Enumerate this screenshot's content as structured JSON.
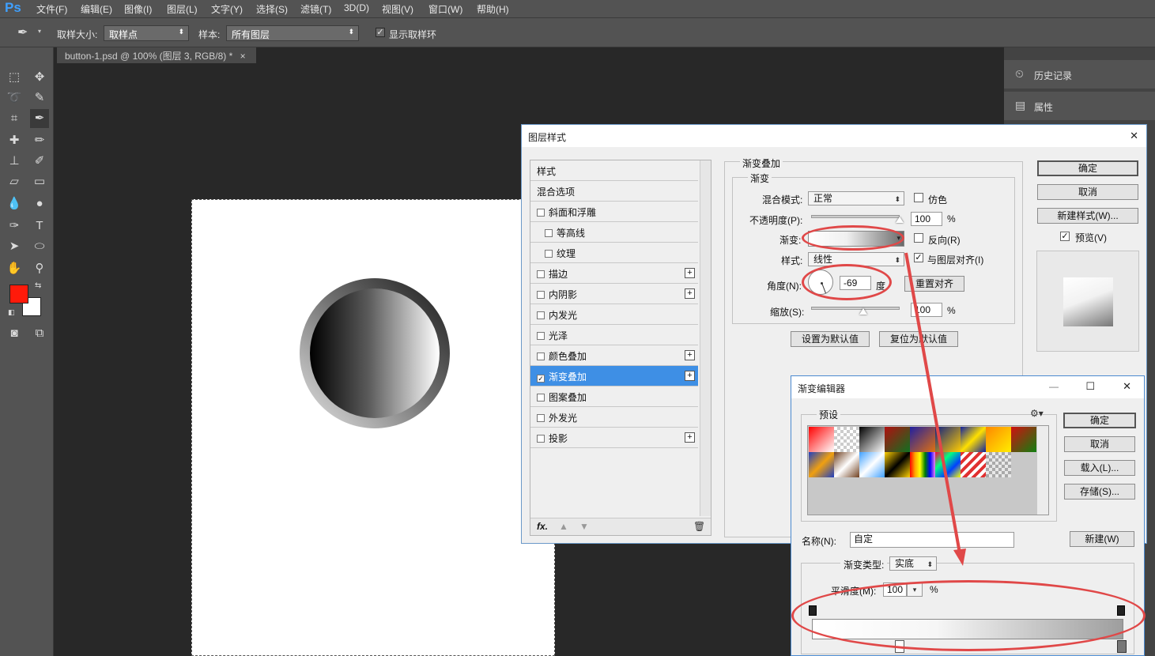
{
  "app": {
    "logo": "Ps"
  },
  "menu": [
    "文件(F)",
    "编辑(E)",
    "图像(I)",
    "图层(L)",
    "文字(Y)",
    "选择(S)",
    "滤镜(T)",
    "3D(D)",
    "视图(V)",
    "窗口(W)",
    "帮助(H)"
  ],
  "options": {
    "sample_size_label": "取样大小:",
    "sample_size_value": "取样点",
    "sample_label": "样本:",
    "sample_value": "所有图层",
    "show_ring_label": "显示取样环"
  },
  "doc_tab": {
    "title": "button-1.psd @ 100% (图层 3, RGB/8) *",
    "close": "×"
  },
  "right_panel": {
    "history": "历史记录",
    "properties": "属性"
  },
  "colors": {
    "foreground": "#ff1a0a",
    "background": "#ffffff",
    "accent": "#3e8fe5",
    "annotation": "#e04848"
  },
  "layer_style": {
    "title": "图层样式",
    "close": "✕",
    "list": [
      {
        "label": "样式",
        "checkbox": false,
        "plus": false,
        "checked": false
      },
      {
        "label": "混合选项",
        "checkbox": false,
        "plus": false,
        "checked": false
      },
      {
        "label": "斜面和浮雕",
        "checkbox": true,
        "plus": false,
        "checked": false
      },
      {
        "label": "等高线",
        "checkbox": true,
        "plus": false,
        "checked": false,
        "indent": true
      },
      {
        "label": "纹理",
        "checkbox": true,
        "plus": false,
        "checked": false,
        "indent": true
      },
      {
        "label": "描边",
        "checkbox": true,
        "plus": true,
        "checked": false
      },
      {
        "label": "内阴影",
        "checkbox": true,
        "plus": true,
        "checked": false
      },
      {
        "label": "内发光",
        "checkbox": true,
        "plus": false,
        "checked": false
      },
      {
        "label": "光泽",
        "checkbox": true,
        "plus": false,
        "checked": false
      },
      {
        "label": "颜色叠加",
        "checkbox": true,
        "plus": true,
        "checked": false
      },
      {
        "label": "渐变叠加",
        "checkbox": true,
        "plus": true,
        "checked": true,
        "selected": true
      },
      {
        "label": "图案叠加",
        "checkbox": true,
        "plus": false,
        "checked": false
      },
      {
        "label": "外发光",
        "checkbox": true,
        "plus": false,
        "checked": false
      },
      {
        "label": "投影",
        "checkbox": true,
        "plus": true,
        "checked": false
      }
    ],
    "footer": {
      "fx": "fx."
    },
    "section_title": "渐变叠加",
    "group_title": "渐变",
    "blend_mode_label": "混合模式:",
    "blend_mode_value": "正常",
    "dither_label": "仿色",
    "opacity_label": "不透明度(P):",
    "opacity_value": "100",
    "opacity_percent": 100,
    "percent": "%",
    "gradient_label": "渐变:",
    "reverse_label": "反向(R)",
    "style_label": "样式:",
    "style_value": "线性",
    "align_label": "与图层对齐(I)",
    "angle_label": "角度(N):",
    "angle_value": "-69",
    "angle_unit": "度",
    "reset_align": "重置对齐",
    "scale_label": "缩放(S):",
    "scale_value": "100",
    "set_default": "设置为默认值",
    "reset_default": "复位为默认值",
    "ok": "确定",
    "cancel": "取消",
    "new_style": "新建样式(W)...",
    "preview": "预览(V)"
  },
  "gradient_editor": {
    "title": "渐变编辑器",
    "presets_label": "预设",
    "ok": "确定",
    "cancel": "取消",
    "load": "载入(L)...",
    "save": "存储(S)...",
    "name_label": "名称(N):",
    "name_value": "自定",
    "new": "新建(W)",
    "type_label": "渐变类型:",
    "type_value": "实底",
    "smooth_label": "平滑度(M):",
    "smooth_value": "100",
    "percent": "%"
  }
}
